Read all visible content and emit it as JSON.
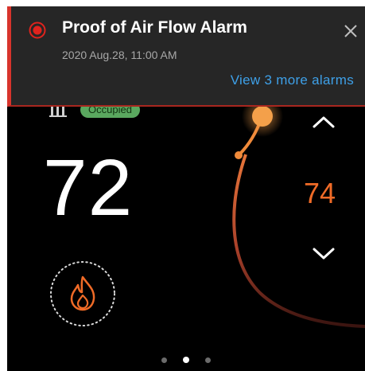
{
  "alarm": {
    "title": "Proof of Air Flow Alarm",
    "timestamp": "2020 Aug.28, 11:00 AM",
    "more_link": "View 3 more alarms",
    "status_color": "#e0231d",
    "link_color": "#3ea0e8",
    "icon": "alarm-indicator-icon",
    "close_icon": "close-icon"
  },
  "thermostat": {
    "occupancy_status": "Occupied",
    "occupancy_icon": "building-icon",
    "current_temperature": "72",
    "setpoint": "74",
    "setpoint_color": "#f06b27",
    "increase_icon": "chevron-up-icon",
    "decrease_icon": "chevron-down-icon",
    "mode_icon": "flame-icon"
  },
  "pager": {
    "pages": 3,
    "active_page": 2
  }
}
